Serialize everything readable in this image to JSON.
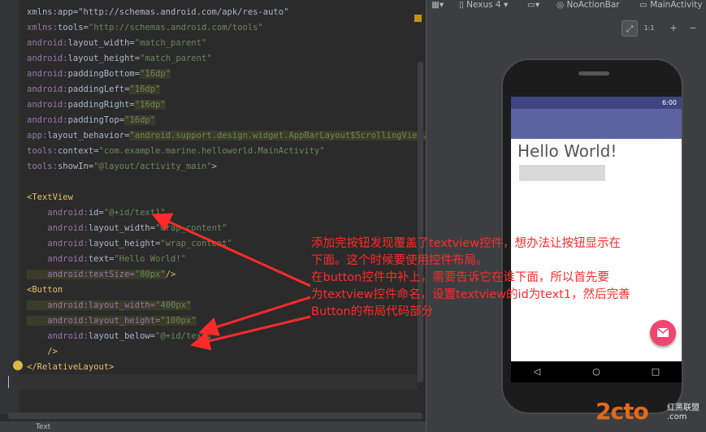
{
  "editor": {
    "lines": [
      {
        "parts": [
          {
            "t": "xmlns:app=\"http://schemas.android.com/apk/res-auto\"",
            "c": "plain"
          }
        ]
      },
      {
        "parts": [
          {
            "t": "xmlns:",
            "c": "attr"
          },
          {
            "t": "tools=",
            "c": "plain"
          },
          {
            "t": "\"http://schemas.android.com/tools\"",
            "c": "str"
          }
        ]
      },
      {
        "parts": [
          {
            "t": "android:",
            "c": "attr"
          },
          {
            "t": "layout_width=",
            "c": "plain"
          },
          {
            "t": "\"match_parent\"",
            "c": "str"
          }
        ]
      },
      {
        "parts": [
          {
            "t": "android:",
            "c": "attr"
          },
          {
            "t": "layout_height=",
            "c": "plain"
          },
          {
            "t": "\"match_parent\"",
            "c": "str"
          }
        ]
      },
      {
        "parts": [
          {
            "t": "android:",
            "c": "attr"
          },
          {
            "t": "paddingBottom=",
            "c": "plain"
          },
          {
            "t": "\"16dp\"",
            "c": "str hl"
          }
        ]
      },
      {
        "parts": [
          {
            "t": "android:",
            "c": "attr"
          },
          {
            "t": "paddingLeft=",
            "c": "plain"
          },
          {
            "t": "\"16dp\"",
            "c": "str hl"
          }
        ]
      },
      {
        "parts": [
          {
            "t": "android:",
            "c": "attr"
          },
          {
            "t": "paddingRight=",
            "c": "plain"
          },
          {
            "t": "\"16dp\"",
            "c": "str hl"
          }
        ]
      },
      {
        "parts": [
          {
            "t": "android:",
            "c": "attr"
          },
          {
            "t": "paddingTop=",
            "c": "plain"
          },
          {
            "t": "\"16dp\"",
            "c": "str hl"
          }
        ]
      },
      {
        "parts": [
          {
            "t": "app:",
            "c": "attr"
          },
          {
            "t": "layout_behavior=",
            "c": "plain"
          },
          {
            "t": "\"android.support.design.widget.AppBarLayout$ScrollingVie...\"",
            "c": "str hl"
          }
        ]
      },
      {
        "parts": [
          {
            "t": "tools:",
            "c": "attr"
          },
          {
            "t": "context=",
            "c": "plain"
          },
          {
            "t": "\"com.example.marine.helloworld.MainActivity\"",
            "c": "str"
          }
        ]
      },
      {
        "parts": [
          {
            "t": "tools:",
            "c": "attr"
          },
          {
            "t": "showIn=",
            "c": "plain"
          },
          {
            "t": "\"@layout/activity_main\"",
            "c": "str"
          },
          {
            "t": ">",
            "c": "plain"
          }
        ]
      },
      {
        "parts": []
      },
      {
        "parts": [
          {
            "t": "<TextView",
            "c": "tag"
          }
        ]
      },
      {
        "parts": [
          {
            "t": "    android:",
            "c": "attr"
          },
          {
            "t": "id=",
            "c": "plain"
          },
          {
            "t": "\"@+id/text1\"",
            "c": "str"
          }
        ]
      },
      {
        "parts": [
          {
            "t": "    android:",
            "c": "attr"
          },
          {
            "t": "layout_width=",
            "c": "plain"
          },
          {
            "t": "\"wrap_content\"",
            "c": "str"
          }
        ]
      },
      {
        "parts": [
          {
            "t": "    android:",
            "c": "attr"
          },
          {
            "t": "layout_height=",
            "c": "plain"
          },
          {
            "t": "\"wrap_content\"",
            "c": "str"
          }
        ]
      },
      {
        "parts": [
          {
            "t": "    android:",
            "c": "attr"
          },
          {
            "t": "text=",
            "c": "plain"
          },
          {
            "t": "\"Hello World!\"",
            "c": "str"
          }
        ]
      },
      {
        "parts": [
          {
            "t": "    android:textSize=",
            "c": "attr hl"
          },
          {
            "t": "\"80px\"",
            "c": "str hl"
          },
          {
            "t": "/>",
            "c": "tag"
          }
        ]
      },
      {
        "parts": [
          {
            "t": "<Button",
            "c": "tag"
          }
        ]
      },
      {
        "parts": [
          {
            "t": "    android:layout_width=",
            "c": "attr hl"
          },
          {
            "t": "\"400px\"",
            "c": "str hl"
          }
        ]
      },
      {
        "parts": [
          {
            "t": "    android:layout_height=",
            "c": "attr hl"
          },
          {
            "t": "\"100px\"",
            "c": "str hl"
          }
        ]
      },
      {
        "parts": [
          {
            "t": "    android:",
            "c": "attr"
          },
          {
            "t": "layout_below=",
            "c": "plain"
          },
          {
            "t": "\"@+id/text1\"",
            "c": "str"
          }
        ]
      },
      {
        "parts": [
          {
            "t": "    />",
            "c": "tag"
          }
        ]
      },
      {
        "parts": [
          {
            "t": "</",
            "c": "tag"
          },
          {
            "t": "RelativeLayout",
            "c": "tag"
          },
          {
            "t": ">",
            "c": "tag"
          }
        ]
      }
    ],
    "bottom_tab": "Text"
  },
  "preview": {
    "toolbar": {
      "device": "Nexus 4",
      "theme": "NoActionBar",
      "activity": "MainActivity"
    },
    "zoom_buttons": [
      "⤢",
      "1:1",
      "+",
      "−"
    ],
    "phone": {
      "clock": "6:00",
      "hello_text": "Hello World!",
      "nav_back": "◁",
      "nav_home": "○",
      "nav_recent": "□"
    }
  },
  "annotation": {
    "line1": "添加完按钮发现覆盖了textview控件，想办法让按钮显示在",
    "line2": "下面。这个时候要使用控件布局。",
    "line3": "在button控件中补上，需要告诉它在谁下面，所以首先要",
    "line4": "为textview控件命名，设置textview的id为text1，然后完善",
    "line5": "Button的布局代码部分"
  },
  "watermark": {
    "logo": "2cto",
    "sub1": "红黑联盟",
    "sub2": ".com"
  },
  "colors": {
    "annotation": "#ff2a2a",
    "fab": "#f0466f",
    "appbar": "#5b63a0",
    "statusbar": "#3f4580"
  }
}
